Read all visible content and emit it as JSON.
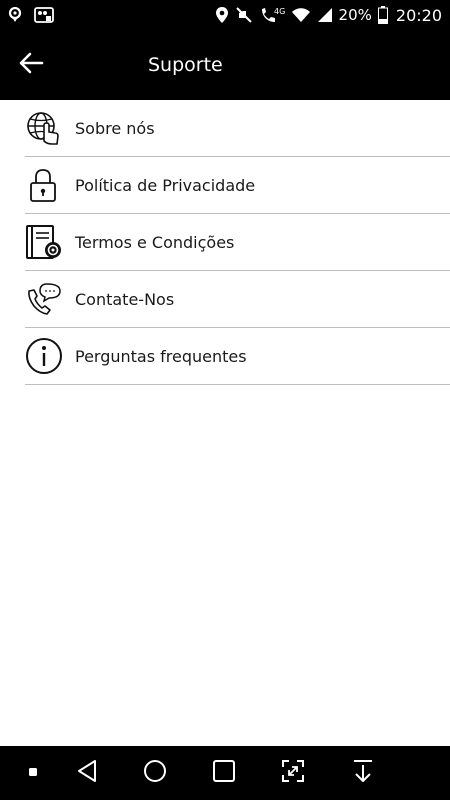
{
  "status_bar": {
    "battery_percent": "20%",
    "time": "20:20",
    "network": "4G",
    "icons": [
      "location-icon",
      "notification-app-icon",
      "location-pin-icon",
      "mute-icon",
      "wifi-call-icon",
      "wifi-icon",
      "signal-icon",
      "battery-icon"
    ]
  },
  "app_bar": {
    "title": "Suporte",
    "back_icon": "arrow-left-icon"
  },
  "menu": {
    "items": [
      {
        "label": "Sobre nós",
        "icon": "globe-hand-icon"
      },
      {
        "label": "Política de Privacidade",
        "icon": "lock-icon"
      },
      {
        "label": "Termos e Condições",
        "icon": "book-gear-icon"
      },
      {
        "label": "Contate-Nos",
        "icon": "phone-chat-icon"
      },
      {
        "label": "Perguntas frequentes",
        "icon": "info-icon"
      }
    ]
  },
  "nav_bar": {
    "icons": [
      "dot-icon",
      "back-triangle-icon",
      "home-circle-icon",
      "recents-square-icon",
      "screenshot-icon",
      "download-arrow-icon"
    ]
  },
  "colors": {
    "bars": "#000000",
    "background": "#ffffff",
    "divider": "#bdbdbd",
    "text": "#1a1a1a"
  }
}
